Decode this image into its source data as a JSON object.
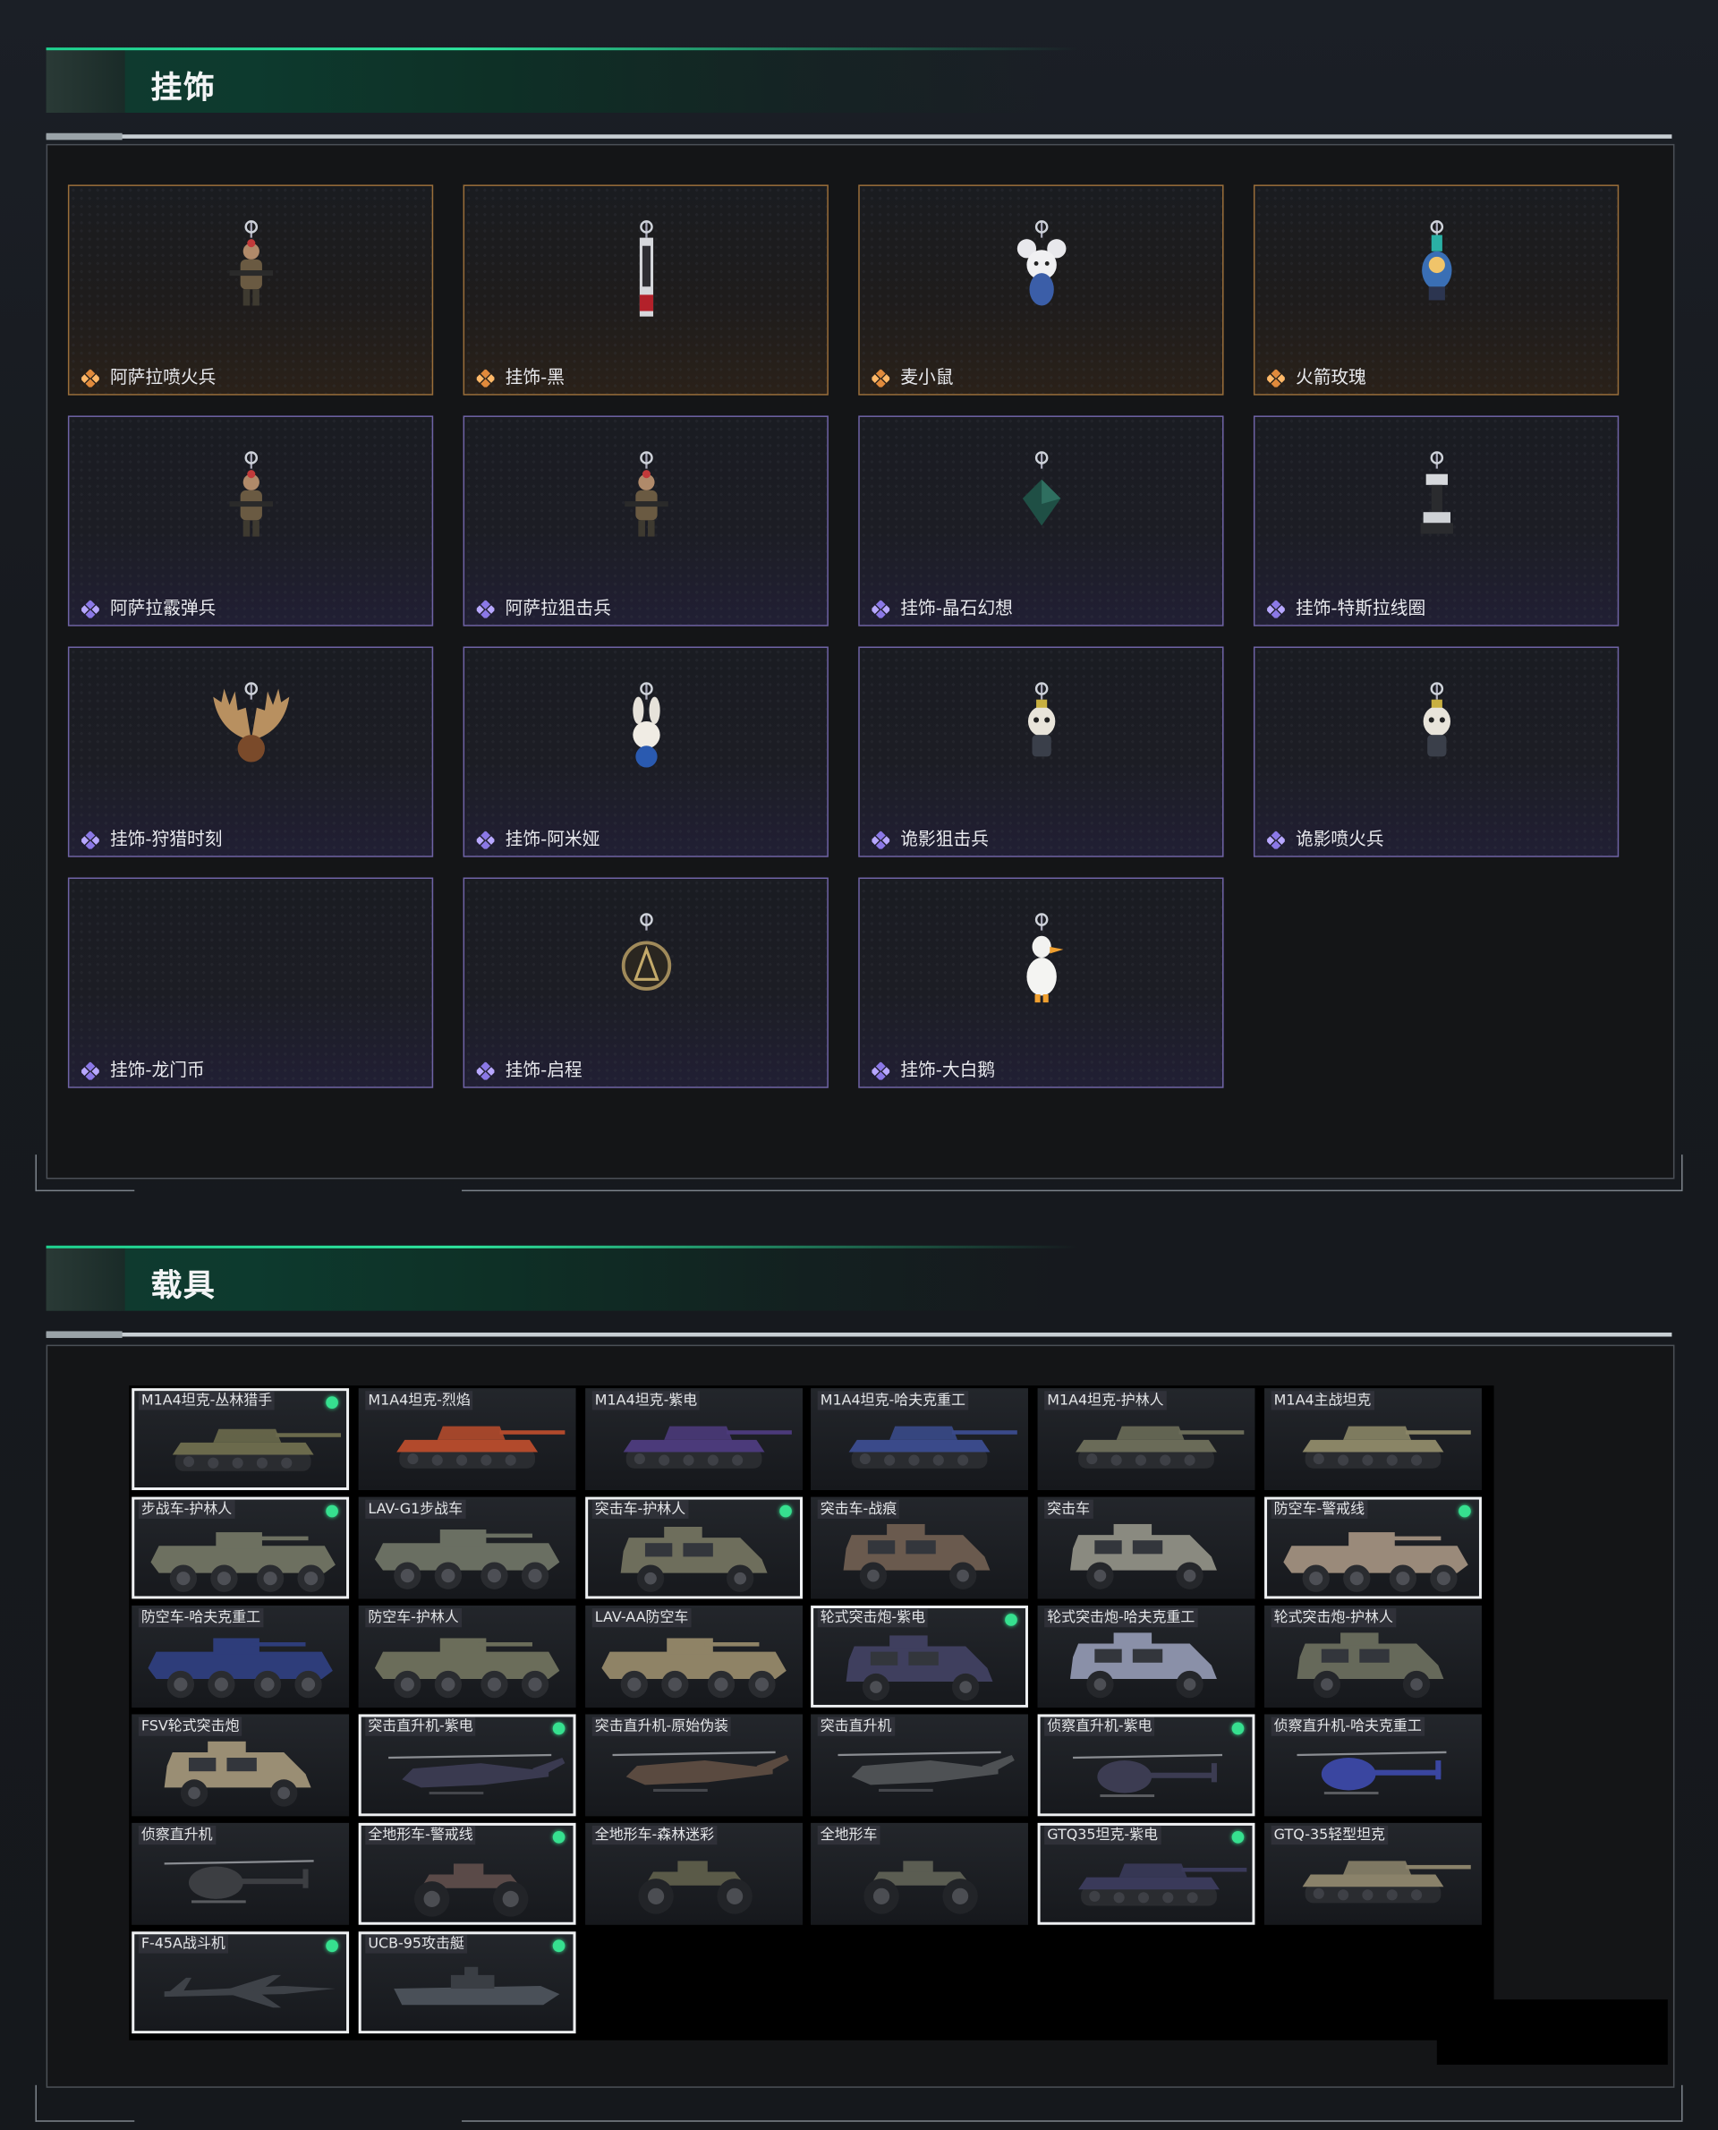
{
  "sections": {
    "pendants": {
      "title": "挂饰"
    },
    "vehicles": {
      "title": "载具"
    }
  },
  "pendants": [
    {
      "label": "阿萨拉喷火兵",
      "rarity": "gold",
      "icon": "soldier-charm"
    },
    {
      "label": "挂饰-黑",
      "rarity": "gold",
      "icon": "tag-charm"
    },
    {
      "label": "麦小鼠",
      "rarity": "gold",
      "icon": "mouse-charm"
    },
    {
      "label": "火箭玫瑰",
      "rarity": "gold",
      "icon": "rocket-charm"
    },
    {
      "label": "阿萨拉霰弹兵",
      "rarity": "purple",
      "icon": "soldier-charm"
    },
    {
      "label": "阿萨拉狙击兵",
      "rarity": "purple",
      "icon": "soldier-charm"
    },
    {
      "label": "挂饰-晶石幻想",
      "rarity": "purple",
      "icon": "crystal-charm"
    },
    {
      "label": "挂饰-特斯拉线圈",
      "rarity": "purple",
      "icon": "tesla-charm"
    },
    {
      "label": "挂饰-狩猎时刻",
      "rarity": "purple",
      "icon": "antler-charm"
    },
    {
      "label": "挂饰-阿米娅",
      "rarity": "purple",
      "icon": "bunny-charm"
    },
    {
      "label": "诡影狙击兵",
      "rarity": "purple",
      "icon": "ghost-charm"
    },
    {
      "label": "诡影喷火兵",
      "rarity": "purple",
      "icon": "ghost-charm"
    },
    {
      "label": "挂饰-龙门币",
      "rarity": "purple",
      "icon": "none"
    },
    {
      "label": "挂饰-启程",
      "rarity": "purple",
      "icon": "coin-charm"
    },
    {
      "label": "挂饰-大白鹅",
      "rarity": "purple",
      "icon": "goose-charm"
    }
  ],
  "vehicles": [
    {
      "label": "M1A4坦克-丛林猎手",
      "selected": true,
      "kind": "tank",
      "color": "#6b6a4c"
    },
    {
      "label": "M1A4坦克-烈焰",
      "selected": false,
      "kind": "tank",
      "color": "#b24a2c"
    },
    {
      "label": "M1A4坦克-紫电",
      "selected": false,
      "kind": "tank",
      "color": "#4b3a7a"
    },
    {
      "label": "M1A4坦克-哈夫克重工",
      "selected": false,
      "kind": "tank",
      "color": "#3a4a8a"
    },
    {
      "label": "M1A4坦克-护林人",
      "selected": false,
      "kind": "tank",
      "color": "#6a6b58"
    },
    {
      "label": "M1A4主战坦克",
      "selected": false,
      "kind": "tank",
      "color": "#8a8566"
    },
    {
      "label": "步战车-护林人",
      "selected": true,
      "kind": "apc",
      "color": "#6d7060"
    },
    {
      "label": "LAV-G1步战车",
      "selected": false,
      "kind": "apc",
      "color": "#6a6f62"
    },
    {
      "label": "突击车-护林人",
      "selected": true,
      "kind": "jeep",
      "color": "#6e6e5c"
    },
    {
      "label": "突击车-战痕",
      "selected": false,
      "kind": "jeep",
      "color": "#6a5a4e"
    },
    {
      "label": "突击车",
      "selected": false,
      "kind": "jeep",
      "color": "#8a8a80"
    },
    {
      "label": "防空车-警戒线",
      "selected": true,
      "kind": "apc",
      "color": "#9a8a7a"
    },
    {
      "label": "防空车-哈夫克重工",
      "selected": false,
      "kind": "apc",
      "color": "#2e3d7a"
    },
    {
      "label": "防空车-护林人",
      "selected": false,
      "kind": "apc",
      "color": "#6b6d5a"
    },
    {
      "label": "LAV-AA防空车",
      "selected": false,
      "kind": "apc",
      "color": "#8f8366"
    },
    {
      "label": "轮式突击炮-紫电",
      "selected": true,
      "kind": "jeep",
      "color": "#3f3f5e"
    },
    {
      "label": "轮式突击炮-哈夫克重工",
      "selected": false,
      "kind": "jeep",
      "color": "#8a90a8"
    },
    {
      "label": "轮式突击炮-护林人",
      "selected": false,
      "kind": "jeep",
      "color": "#66695a"
    },
    {
      "label": "FSV轮式突击炮",
      "selected": false,
      "kind": "jeep",
      "color": "#9a8e74"
    },
    {
      "label": "突击直升机-紫电",
      "selected": true,
      "kind": "heli",
      "color": "#3a3a50"
    },
    {
      "label": "突击直升机-原始伪装",
      "selected": false,
      "kind": "heli",
      "color": "#5a4a40"
    },
    {
      "label": "突击直升机",
      "selected": false,
      "kind": "heli",
      "color": "#4e5154"
    },
    {
      "label": "侦察直升机-紫电",
      "selected": true,
      "kind": "littlebird",
      "color": "#3c3c52"
    },
    {
      "label": "侦察直升机-哈夫克重工",
      "selected": false,
      "kind": "littlebird",
      "color": "#3a46a0"
    },
    {
      "label": "侦察直升机",
      "selected": false,
      "kind": "littlebird",
      "color": "#3c3e42"
    },
    {
      "label": "全地形车-警戒线",
      "selected": true,
      "kind": "atv",
      "color": "#5a4a48"
    },
    {
      "label": "全地形车-森林迷彩",
      "selected": false,
      "kind": "atv",
      "color": "#5a5a48"
    },
    {
      "label": "全地形车",
      "selected": false,
      "kind": "atv",
      "color": "#5b5d52"
    },
    {
      "label": "GTQ35坦克-紫电",
      "selected": true,
      "kind": "tank",
      "color": "#3a3a5a"
    },
    {
      "label": "GTQ-35轻型坦克",
      "selected": false,
      "kind": "tank",
      "color": "#8a826a"
    },
    {
      "label": "F-45A战斗机",
      "selected": true,
      "kind": "jet",
      "color": "#3e4248"
    },
    {
      "label": "UCB-95攻击艇",
      "selected": true,
      "kind": "boat",
      "color": "#4a5058"
    }
  ],
  "colors": {
    "accent": "#2ee59e",
    "gold": "#e08a3c",
    "purple": "#8b78e6",
    "selected_dot": "#36e08f"
  }
}
